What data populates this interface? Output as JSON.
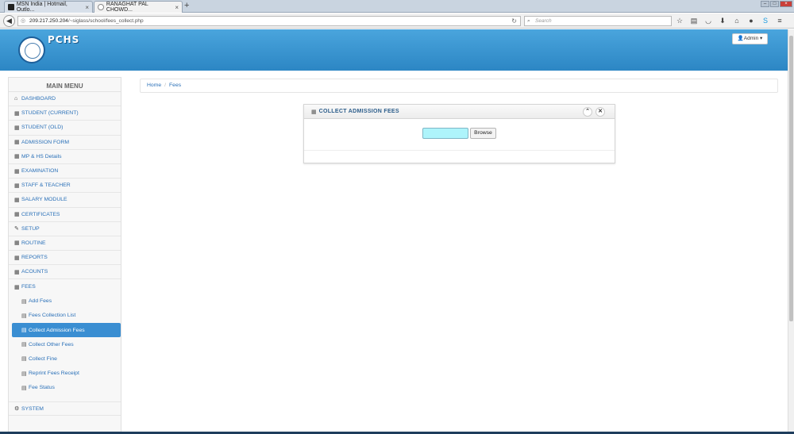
{
  "browser": {
    "tabs": [
      {
        "label": "MSN India | Hotmail, Outlo...",
        "active": false
      },
      {
        "label": "RANAGHAT PAL CHOWD...",
        "active": true
      }
    ],
    "new_tab_label": "+",
    "url_host": "209.217.250.204",
    "url_path": "/~siglass/school/fees_collect.php",
    "search_placeholder": "Search"
  },
  "header": {
    "brand": "PCHS",
    "admin_label": "Admin"
  },
  "sidebar": {
    "title": "MAIN MENU",
    "items": [
      {
        "label": "DASHBOARD",
        "icon": "home-icon"
      },
      {
        "label": "STUDENT (CURRENT)",
        "icon": "grid-icon"
      },
      {
        "label": "STUDENT (OLD)",
        "icon": "grid-icon"
      },
      {
        "label": "ADMISSION FORM",
        "icon": "grid-icon"
      },
      {
        "label": "MP & HS Details",
        "icon": "grid-icon"
      },
      {
        "label": "EXAMINATION",
        "icon": "grid-icon"
      },
      {
        "label": "STAFF & TEACHER",
        "icon": "grid-icon"
      },
      {
        "label": "SALARY MODULE",
        "icon": "grid-icon"
      },
      {
        "label": "CERTIFICATES",
        "icon": "grid-icon"
      },
      {
        "label": "SETUP",
        "icon": "wrench-icon"
      },
      {
        "label": "ROUTINE",
        "icon": "grid-icon"
      },
      {
        "label": "REPORTS",
        "icon": "grid-icon"
      },
      {
        "label": "ACOUNTS",
        "icon": "grid-icon"
      },
      {
        "label": "FEES",
        "icon": "grid-icon"
      }
    ],
    "fees_sub": [
      {
        "label": "Add Fees"
      },
      {
        "label": "Fees Collection List"
      },
      {
        "label": "Collect Admission Fees",
        "active": true
      },
      {
        "label": "Collect Other Fees"
      },
      {
        "label": "Collect Fine"
      },
      {
        "label": "Reprint Fees Receipt"
      },
      {
        "label": "Fee Status"
      }
    ],
    "system_label": "SYSTEM"
  },
  "breadcrumb": {
    "home": "Home",
    "separator": "/",
    "current": "Fees"
  },
  "widget": {
    "title": "COLLECT ADMISSION FEES",
    "browse_label": "Browse"
  },
  "colors": {
    "header_blue": "#2c86c4",
    "link_blue": "#2a70b8",
    "active_blue": "#3a8ed2",
    "file_input_bg": "#aef4fb"
  }
}
